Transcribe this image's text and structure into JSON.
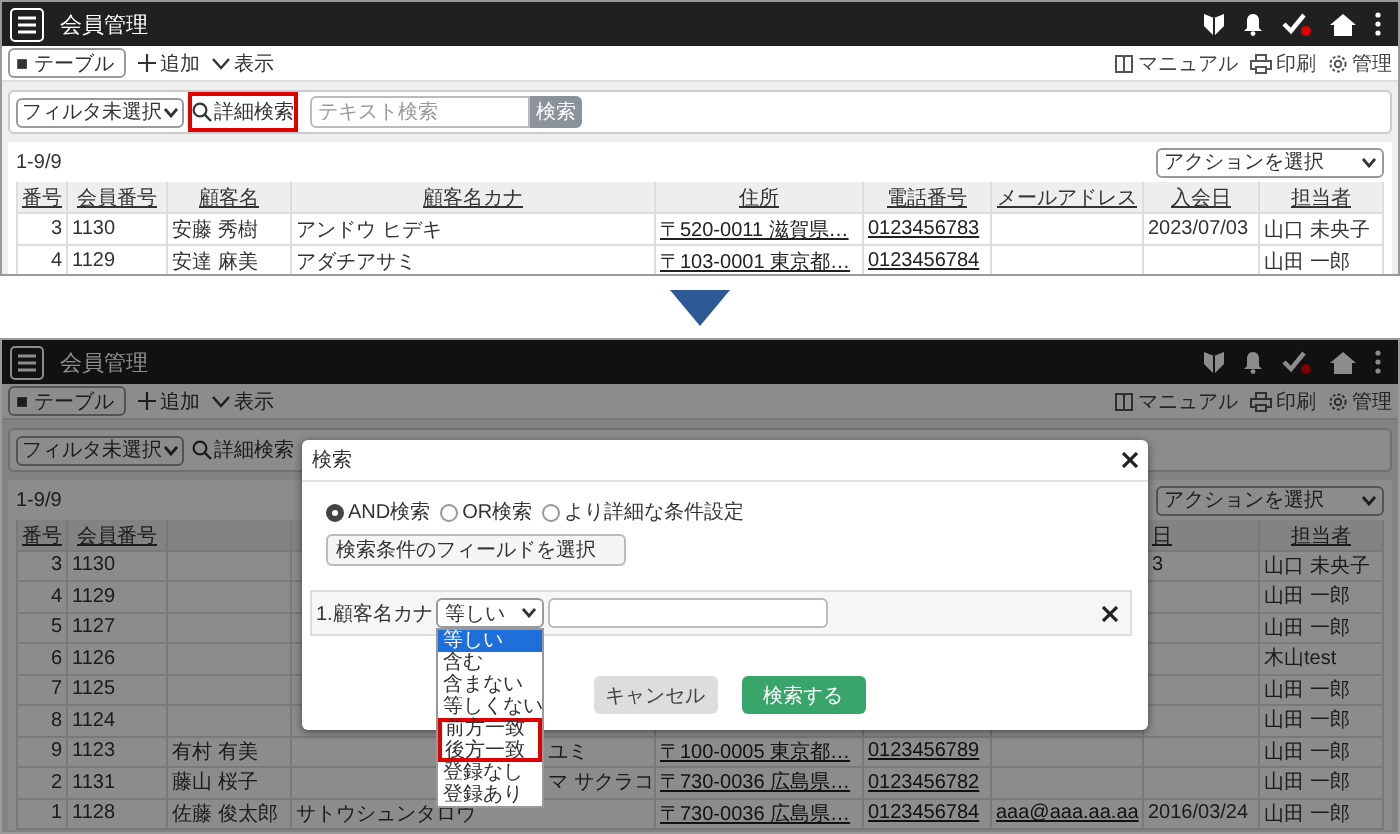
{
  "screens": [
    {
      "title": "会員管理",
      "toolbar": {
        "view_select": "■ テーブル",
        "actions": [
          "追加",
          "表示"
        ],
        "links": [
          "マニュアル",
          "印刷",
          "管理"
        ]
      },
      "filter_bar": {
        "filter_select": "フィルタ未選択",
        "advanced_search": {
          "label": "詳細検索",
          "highlighted": true
        },
        "text_search": {
          "placeholder": "テキスト検索"
        },
        "search_button": "検索"
      },
      "table": {
        "count": "1-9/9",
        "action_select": "アクションを選択",
        "columns": {
          "no": "番号",
          "member_no": "会員番号",
          "name": "顧客名",
          "kana": "顧客名カナ",
          "address": "住所",
          "phone": "電話番号",
          "email": "メールアドレス",
          "joined": "入会日",
          "staff": "担当者"
        },
        "rows": [
          {
            "no": "3",
            "member_no": "1130",
            "name": "安藤 秀樹",
            "kana": "アンドウ ヒデキ",
            "address": "〒520-0011 滋賀県…",
            "phone": "0123456783",
            "joined": "2023/07/03",
            "staff": "山口 未央子"
          },
          {
            "no": "4",
            "member_no": "1129",
            "name": "安達 麻美",
            "kana": "アダチアサミ",
            "address": "〒103-0001 東京都…",
            "phone": "0123456784",
            "staff": "山田 一郎"
          }
        ]
      }
    },
    {
      "title": "会員管理",
      "dimmed": true,
      "toolbar": {
        "view_select": "■ テーブル",
        "actions": [
          "追加",
          "表示"
        ],
        "links": [
          "マニュアル",
          "印刷",
          "管理"
        ]
      },
      "filter_bar": {
        "filter_select": "フィルタ未選択",
        "advanced_search": {
          "label": "詳細検索",
          "highlighted": false
        }
      },
      "table": {
        "count": "1-9/9",
        "action_select": "アクションを選択",
        "columns": {
          "no": "番号",
          "member_no": "会員番号",
          "joined": {
            "text": "日",
            "partly_covered": true
          },
          "staff": "担当者"
        },
        "rows": [
          {
            "no": "3",
            "member_no": "1130",
            "joined": {
              "text": "3",
              "partly_covered": true
            },
            "staff": "山口 未央子"
          },
          {
            "no": "4",
            "member_no": "1129",
            "staff": "山田 一郎"
          },
          {
            "no": "5",
            "member_no": "1127",
            "staff": "山田 一郎"
          },
          {
            "no": "6",
            "member_no": "1126",
            "staff": "木山test"
          },
          {
            "no": "7",
            "member_no": "1125",
            "staff": "山田 一郎"
          },
          {
            "no": "8",
            "member_no": "1124",
            "staff": "山田 一郎"
          },
          {
            "no": "9",
            "member_no": "1123",
            "name": "有村 有美",
            "kana": {
              "text": "ユミ",
              "partly_covered": true
            },
            "address": "〒100-0005 東京都…",
            "phone": "0123456789",
            "staff": "山田 一郎"
          },
          {
            "no": "2",
            "member_no": "1131",
            "name": "藤山 桜子",
            "kana": {
              "text": "マ サクラコ",
              "partly_covered": true
            },
            "address": "〒730-0036 広島県…",
            "phone": "0123456782",
            "staff": "山田 一郎"
          },
          {
            "no": "1",
            "member_no": "1128",
            "name": "佐藤 俊太郎",
            "kana": "サトウシュンタロウ",
            "address": "〒730-0036 広島県…",
            "phone": "0123456784",
            "email": "aaa@aaa.aa.aa",
            "joined": "2016/03/24",
            "staff": "山田 一郎"
          }
        ]
      },
      "modal": {
        "title": "検索",
        "match_modes": [
          {
            "label": "AND検索",
            "selected": true
          },
          {
            "label": "OR検索",
            "selected": false
          },
          {
            "label": "より詳細な条件設定",
            "selected": false
          }
        ],
        "field_select": "検索条件のフィールドを選択",
        "conditions": [
          {
            "field": "1.顧客名カナ",
            "operator": "等しい",
            "expanded": true,
            "options": [
              {
                "label": "等しい",
                "selected": true,
                "highlighted": false
              },
              {
                "label": "含む",
                "selected": false,
                "highlighted": false
              },
              {
                "label": "含まない",
                "selected": false,
                "highlighted": false
              },
              {
                "label": "等しくない",
                "selected": false,
                "highlighted": false
              },
              {
                "label": "前方一致",
                "selected": false,
                "highlighted": true
              },
              {
                "label": "後方一致",
                "selected": false,
                "highlighted": true
              },
              {
                "label": "登録なし",
                "selected": false,
                "highlighted": false
              },
              {
                "label": "登録あり",
                "selected": false,
                "highlighted": false
              }
            ]
          }
        ],
        "buttons": [
          {
            "label": "キャンセル",
            "kind": "secondary"
          },
          {
            "label": "検索する",
            "kind": "primary"
          }
        ]
      }
    }
  ]
}
